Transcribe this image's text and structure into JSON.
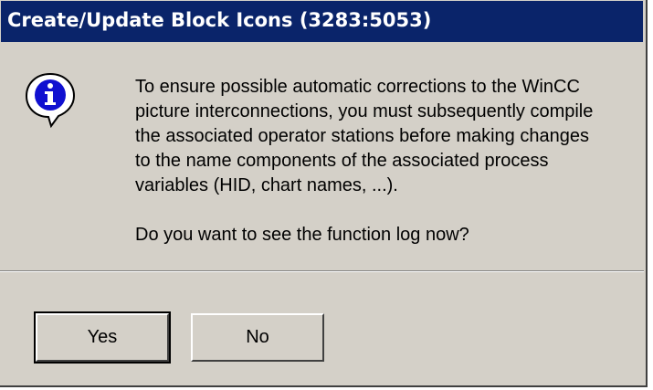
{
  "window": {
    "title": "Create/Update Block Icons  (3283:5053)"
  },
  "dialog": {
    "icon": "information-icon",
    "message_lines": [
      "To ensure possible automatic corrections to the WinCC",
      "picture interconnections, you must subsequently compile",
      "the associated operator stations before making changes",
      "to the name components of the associated process",
      "variables (HID, chart names, ...)."
    ],
    "question": "Do you want to see the function log now?"
  },
  "buttons": {
    "yes_label": "Yes",
    "no_label": "No"
  },
  "colors": {
    "titlebar": "#0a246a",
    "dialog_bg": "#d4d0c8"
  }
}
